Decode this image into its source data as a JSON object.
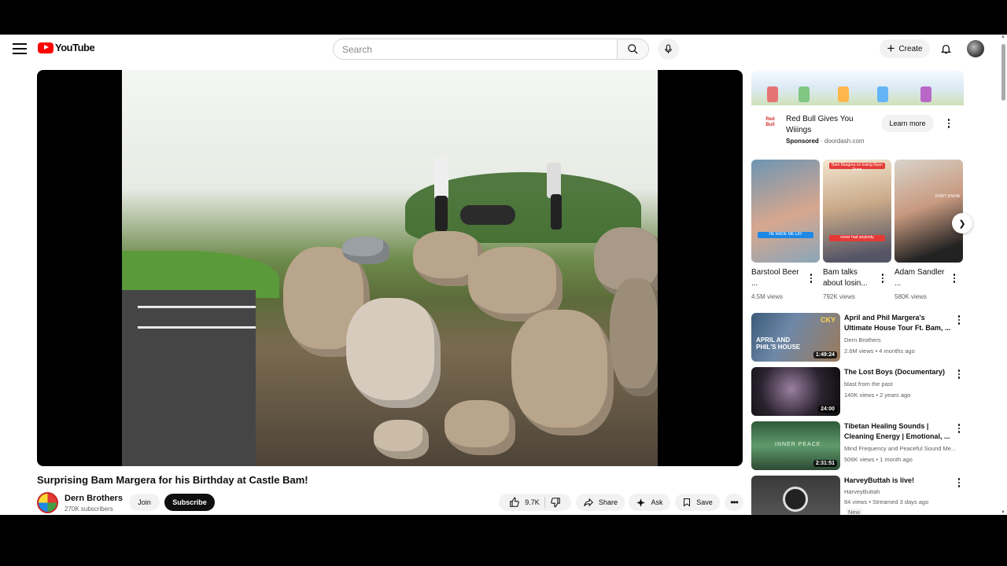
{
  "header": {
    "logo_text": "YouTube",
    "search_placeholder": "Search",
    "create_label": "Create",
    "icons": [
      "menu-icon",
      "search-icon",
      "mic-icon",
      "plus-icon",
      "bell-icon"
    ]
  },
  "video": {
    "title": "Surprising Bam Margera for his Birthday at Castle Bam!",
    "channel": "Dern Brothers",
    "subscribers": "270K subscribers",
    "join_label": "Join",
    "subscribe_label": "Subscribe",
    "likes": "9.7K",
    "share_label": "Share",
    "ask_label": "Ask",
    "save_label": "Save"
  },
  "ad": {
    "logo_text": "Red Bull",
    "title": "Red Bull Gives You Wiiings",
    "sponsored": "Sponsored",
    "domain": "doordash.com",
    "learn_more": "Learn more"
  },
  "shorts": [
    {
      "title": "Barstool Beer ...",
      "views": "4.5M views",
      "caption": "HE MADE ME LAY"
    },
    {
      "title": "Bam talks about losin...",
      "views": "792K views",
      "caption": "never had anybody",
      "top_caption": "Bam Margera on losing Ryan Dunn"
    },
    {
      "title": "Adam Sandler ...",
      "views": "580K views",
      "caption": "DON'T KNOW"
    }
  ],
  "recommendations": [
    {
      "title": "April and Phil Margera's Ultimate House Tour Ft. Bam, ...",
      "channel": "Dern Brothers",
      "meta": "2.6M views • 4 months ago",
      "duration": "1:49:24",
      "thumb_text": "APRIL AND PHIL'S HOUSE",
      "thumb_tag": "CKY"
    },
    {
      "title": "The Lost Boys (Documentary)",
      "channel": "blast from the past",
      "meta": "140K views • 2 years ago",
      "duration": "24:00"
    },
    {
      "title": "Tibetan Healing Sounds | Cleaning Energy | Emotional, ...",
      "channel": "Mind Frequency and Peaceful Sound Me...",
      "meta": "506K views • 1 month ago",
      "duration": "2:31:51",
      "thumb_text": "INNER PEACE"
    },
    {
      "title": "HarveyButtah is live!",
      "channel": "HarveyButtah",
      "meta": "84 views • Streamed 3 days ago",
      "badge": "New"
    }
  ]
}
